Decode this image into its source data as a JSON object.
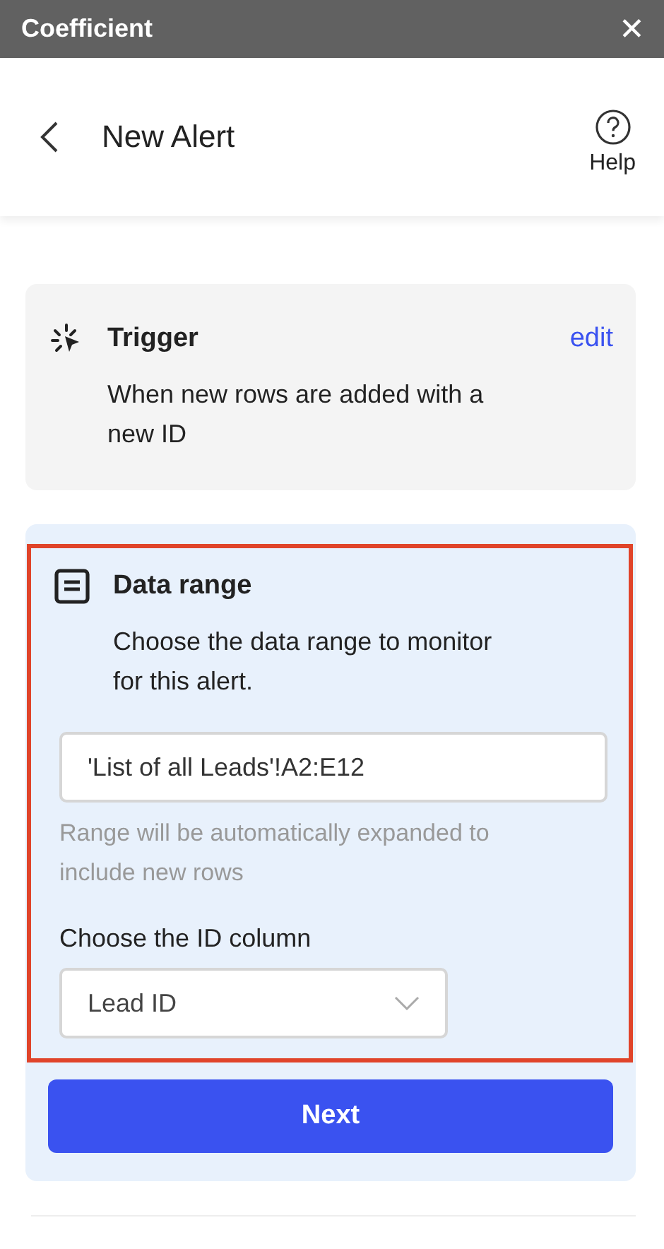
{
  "window": {
    "title": "Coefficient",
    "close": "✕"
  },
  "header": {
    "title": "New Alert",
    "help": "Help"
  },
  "trigger": {
    "title": "Trigger",
    "action": "edit",
    "description": "When new rows are added with a new ID"
  },
  "data_range": {
    "title": "Data range",
    "highlighted": true,
    "description": "Choose the data range to monitor for this alert.",
    "range_value": "'List of all Leads'!A2:E12",
    "hint": "Range will be automatically expanded to include new rows",
    "id_label": "Choose the ID column",
    "id_value": "Lead ID",
    "next": "Next"
  }
}
